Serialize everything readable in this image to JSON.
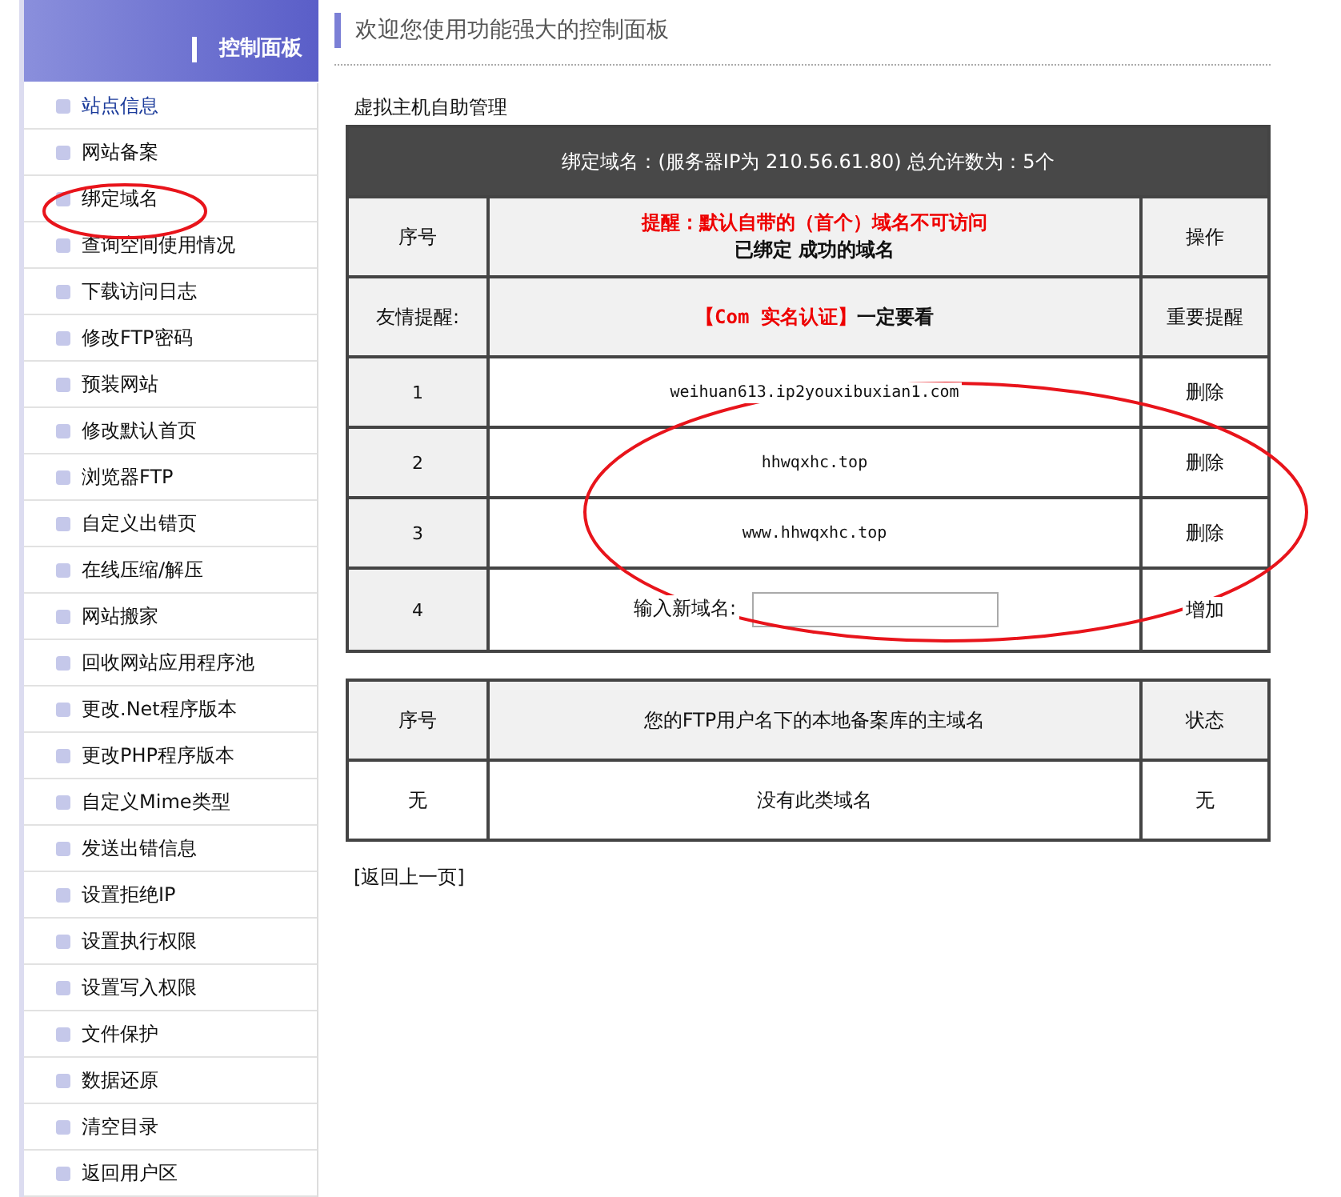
{
  "sidebar": {
    "title": "控制面板",
    "items": [
      {
        "label": "站点信息",
        "selected": true
      },
      {
        "label": "网站备案",
        "selected": false
      },
      {
        "label": "绑定域名",
        "selected": false
      },
      {
        "label": "查询空间使用情况",
        "selected": false
      },
      {
        "label": "下载访问日志",
        "selected": false
      },
      {
        "label": "修改FTP密码",
        "selected": false
      },
      {
        "label": "预装网站",
        "selected": false
      },
      {
        "label": "修改默认首页",
        "selected": false
      },
      {
        "label": "浏览器FTP",
        "selected": false
      },
      {
        "label": "自定义出错页",
        "selected": false
      },
      {
        "label": "在线压缩/解压",
        "selected": false
      },
      {
        "label": "网站搬家",
        "selected": false
      },
      {
        "label": "回收网站应用程序池",
        "selected": false
      },
      {
        "label": "更改.Net程序版本",
        "selected": false
      },
      {
        "label": "更改PHP程序版本",
        "selected": false
      },
      {
        "label": "自定义Mime类型",
        "selected": false
      },
      {
        "label": "发送出错信息",
        "selected": false
      },
      {
        "label": "设置拒绝IP",
        "selected": false
      },
      {
        "label": "设置执行权限",
        "selected": false
      },
      {
        "label": "设置写入权限",
        "selected": false
      },
      {
        "label": "文件保护",
        "selected": false
      },
      {
        "label": "数据还原",
        "selected": false
      },
      {
        "label": "清空目录",
        "selected": false
      },
      {
        "label": "返回用户区",
        "selected": false
      }
    ]
  },
  "page_title": "欢迎您使用功能强大的控制面板",
  "section_title": "虚拟主机自助管理",
  "domain_table": {
    "caption": "绑定域名：(服务器IP为 210.56.61.80)  总允许数为：5个",
    "columns": [
      {
        "label": "序号"
      },
      {
        "warning": "提醒：默认自带的（首个）域名不可访问",
        "label": "已绑定 成功的域名"
      },
      {
        "label": "操作"
      }
    ],
    "notice": {
      "label": "友情提醒:",
      "link": "【Com 实名认证】",
      "text": "一定要看",
      "action": "重要提醒"
    },
    "rows": [
      {
        "kind": "domain",
        "index": "1",
        "domain": "weihuan613.ip2youxibuxian1.com",
        "action": "删除"
      },
      {
        "kind": "domain",
        "index": "2",
        "domain": "hhwqxhc.top",
        "action": "删除"
      },
      {
        "kind": "domain",
        "index": "3",
        "domain": "www.hhwqxhc.top",
        "action": "删除"
      },
      {
        "kind": "input",
        "index": "4",
        "label": "输入新域名:",
        "action": "增加"
      }
    ]
  },
  "record_table": {
    "columns": [
      "序号",
      "您的FTP用户名下的本地备案库的主域名",
      "状态"
    ],
    "rows": [
      [
        "无",
        "没有此类域名",
        "无"
      ]
    ]
  },
  "back_link": "[返回上一页]",
  "annotations": [
    {
      "kind": "ellipse"
    },
    {
      "kind": "ellipse"
    }
  ]
}
